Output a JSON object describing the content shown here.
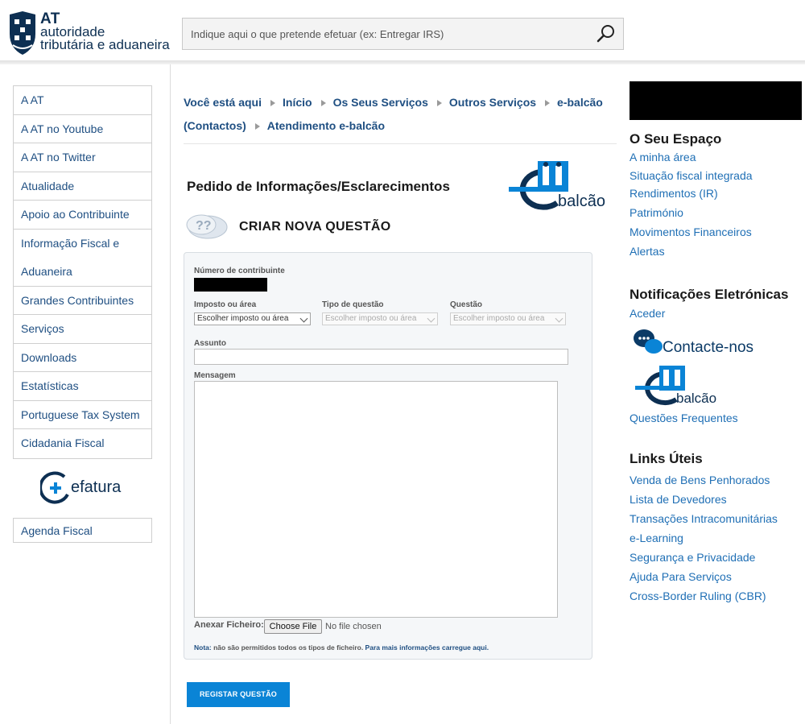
{
  "header": {
    "logo": {
      "line1": "AT",
      "line2": "autoridade",
      "line3": "tributária e aduaneira"
    },
    "search_placeholder": "Indique aqui o que pretende efetuar (ex: Entregar IRS)"
  },
  "leftnav": {
    "items": [
      "A AT",
      "A AT no Youtube",
      "A AT no Twitter",
      "Atualidade",
      "Apoio ao Contribuinte",
      "Informação Fiscal e Aduaneira",
      "Grandes Contribuintes",
      "Serviços",
      "Downloads",
      "Estatísticas",
      "Portuguese Tax System",
      "Cidadania Fiscal"
    ],
    "efatura_label": "efatura",
    "agenda": "Agenda Fiscal"
  },
  "breadcrumb": {
    "here": "Você está aqui",
    "items": [
      "Início",
      "Os Seus Serviços",
      "Outros Serviços",
      "e-balcão (Contactos)",
      "Atendimento e-balcão"
    ],
    "item4a": "e-balcão",
    "item4b": "(Contactos)"
  },
  "main": {
    "title": "Pedido de Informações/Esclarecimentos",
    "ebalcao_label": "balcão",
    "section_title": "CRIAR NOVA QUESTÃO"
  },
  "form": {
    "nif_label": "Número de contribuinte",
    "imposto_label": "Imposto ou área",
    "imposto_value": "Escolher imposto ou área",
    "tipo_label": "Tipo de questão",
    "tipo_value": "Escolher imposto ou área",
    "questao_label": "Questão",
    "questao_value": "Escolher imposto ou área",
    "assunto_label": "Assunto",
    "mensagem_label": "Mensagem",
    "anexar_label": "Anexar Ficheiro:",
    "file_button": "Choose File",
    "file_none": "No file chosen",
    "note_label": "Nota:",
    "note_text": " não são permitidos todos os tipos de ficheiro. ",
    "note_link": "Para mais informações carregue aqui.",
    "submit": "REGISTAR QUESTÃO"
  },
  "right": {
    "espaco_title": "O Seu Espaço",
    "espaco_links": [
      "A minha área",
      "Situação fiscal integrada",
      "Rendimentos (IR)",
      "Património",
      "Movimentos Financeiros",
      "Alertas"
    ],
    "notif_title": "Notificações Eletrónicas",
    "notif_link": "Aceder",
    "contacte": "Contacte-nos",
    "ebalcao_label": "balcão",
    "faq": "Questões Frequentes",
    "links_title": "Links Úteis",
    "links": [
      "Venda de Bens Penhorados",
      "Lista de Devedores",
      "Transações Intracomunitárias",
      "e-Learning",
      "Segurança e Privacidade",
      "Ajuda Para Serviços",
      "Cross-Border Ruling (CBR)"
    ]
  },
  "colors": {
    "link": "#1f4f82",
    "accent_blue": "#0a84d6",
    "right_link": "#1f6fb5"
  }
}
